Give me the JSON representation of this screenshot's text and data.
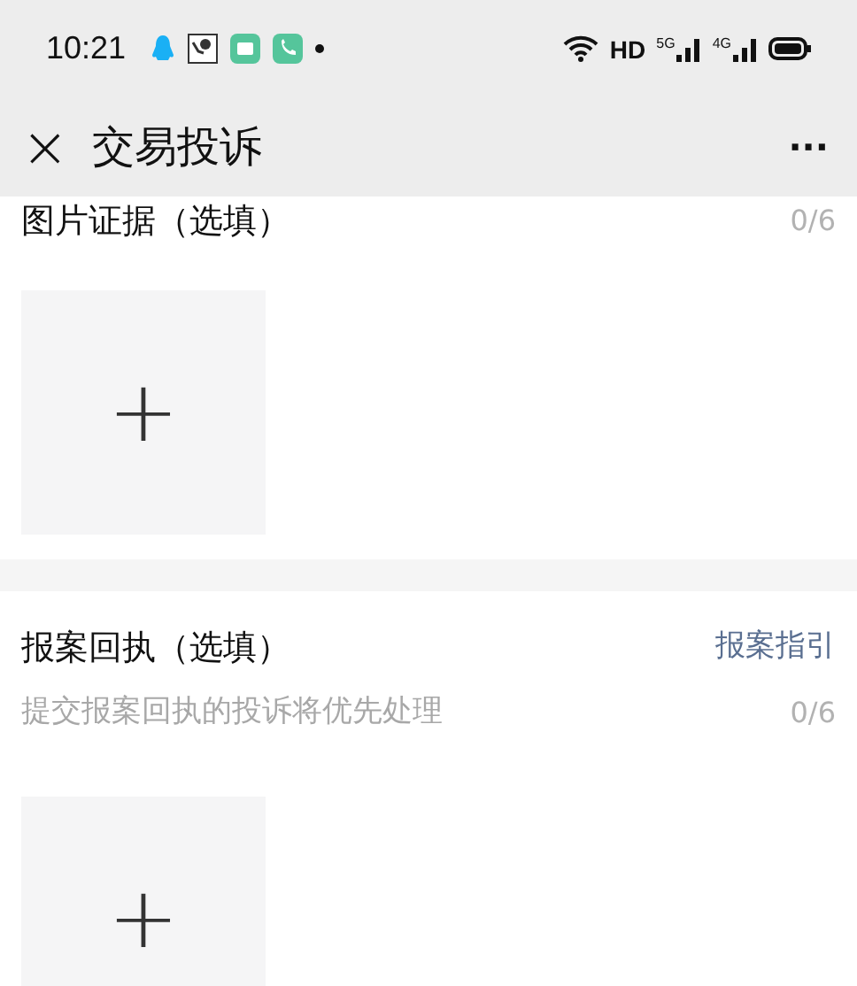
{
  "status_bar": {
    "time": "10:21",
    "network_label": "HD",
    "sim_1": "5G",
    "sim_2": "4G"
  },
  "nav": {
    "title": "交易投诉",
    "close": "×",
    "more": "···"
  },
  "sections": [
    {
      "title": "图片证据（选填）",
      "counter": "0/6",
      "upload_icon": "+"
    },
    {
      "title": "报案回执（选填）",
      "counter": "0/6",
      "link": "报案指引",
      "hint": "提交报案回执的投诉将优先处理",
      "upload_icon": "+"
    }
  ]
}
